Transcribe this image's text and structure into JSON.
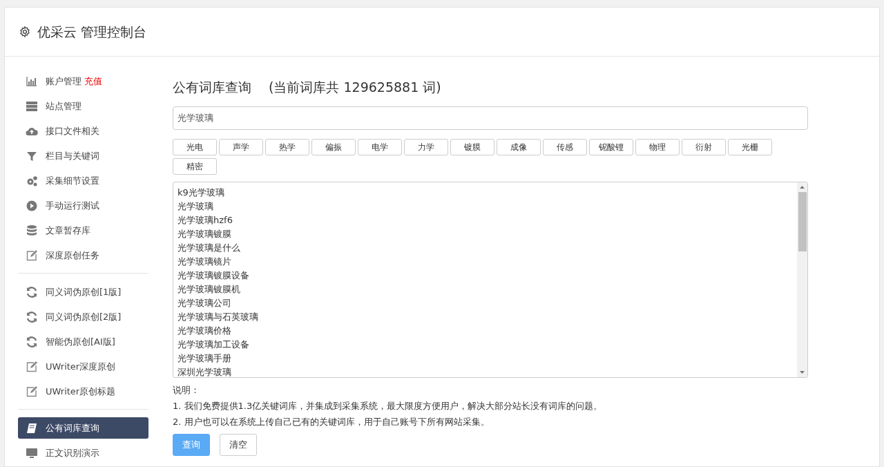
{
  "header": {
    "title": "优采云 管理控制台"
  },
  "sidebar": {
    "groups": [
      [
        {
          "label": "账户管理",
          "badge": "充值",
          "selected": false
        },
        {
          "label": "站点管理",
          "selected": false
        },
        {
          "label": "接口文件相关",
          "selected": false
        },
        {
          "label": "栏目与关键词",
          "selected": false
        },
        {
          "label": "采集细节设置",
          "selected": false
        },
        {
          "label": "手动运行测试",
          "selected": false
        },
        {
          "label": "文章暂存库",
          "selected": false
        },
        {
          "label": "深度原创任务",
          "selected": false
        }
      ],
      [
        {
          "label": "同义词伪原创[1版]",
          "selected": false
        },
        {
          "label": "同义词伪原创[2版]",
          "selected": false
        },
        {
          "label": "智能伪原创[AI版]",
          "selected": false
        },
        {
          "label": "UWriter深度原创",
          "selected": false
        },
        {
          "label": "UWriter原创标题",
          "selected": false
        }
      ],
      [
        {
          "label": "公有词库查询",
          "selected": true
        },
        {
          "label": "正文识别演示",
          "selected": false
        }
      ]
    ]
  },
  "main": {
    "title": "公有词库查询",
    "count_note": "(当前词库共 129625881 词)",
    "search": {
      "value": "光学玻璃"
    },
    "tags": [
      "光电",
      "声学",
      "热学",
      "偏振",
      "电学",
      "力学",
      "镀膜",
      "成像",
      "传感",
      "铌酸锂",
      "物理",
      "衍射",
      "光栅",
      "精密"
    ],
    "results": [
      "k9光学玻璃",
      "光学玻璃",
      "光学玻璃hzf6",
      "光学玻璃镀膜",
      "光学玻璃是什么",
      "光学玻璃镜片",
      "光学玻璃镀膜设备",
      "光学玻璃镀膜机",
      "光学玻璃公司",
      "光学玻璃与石英玻璃",
      "光学玻璃价格",
      "光学玻璃加工设备",
      "光学玻璃手册",
      "深圳光学玻璃"
    ],
    "notes_title": "说明：",
    "notes": [
      "1. 我们免费提供1.3亿关键词库，并集成到采集系统，最大限度方便用户，解决大部分站长没有词库的问题。",
      "2. 用户也可以在系统上传自己已有的关键词库，用于自己账号下所有网站采集。"
    ],
    "buttons": [
      {
        "kind": "primary",
        "label": "查询"
      },
      {
        "kind": "default",
        "label": "清空"
      }
    ]
  }
}
